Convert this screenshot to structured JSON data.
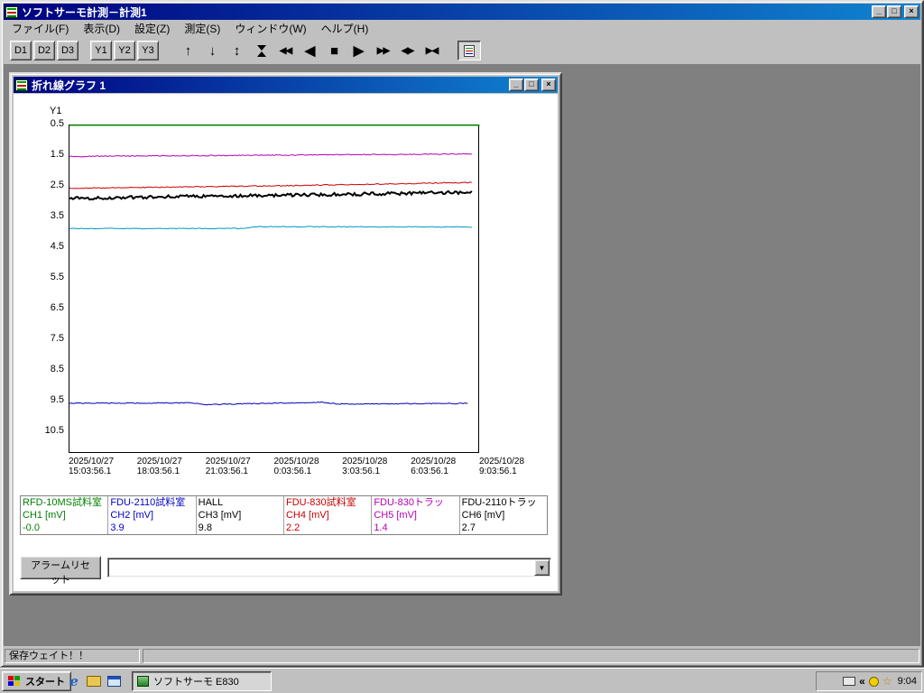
{
  "main_window": {
    "title": "ソフトサーモ計測－計測1",
    "menu_items": [
      "ファイル(F)",
      "表示(D)",
      "設定(Z)",
      "測定(S)",
      "ウィンドウ(W)",
      "ヘルプ(H)"
    ],
    "toolbar": {
      "display_buttons": [
        "D1",
        "D2",
        "D3"
      ],
      "axis_buttons": [
        "Y1",
        "Y2",
        "Y3"
      ],
      "nav_buttons": [
        {
          "name": "scroll-up",
          "glyph": "↑"
        },
        {
          "name": "scroll-down",
          "glyph": "↓"
        },
        {
          "name": "scroll-up-down",
          "glyph": "↕"
        },
        {
          "name": "hourglass",
          "glyph": ""
        },
        {
          "name": "rewind",
          "glyph": "◀◀"
        },
        {
          "name": "step-back",
          "glyph": "◀"
        },
        {
          "name": "stop",
          "glyph": "■"
        },
        {
          "name": "step-forward",
          "glyph": "▶"
        },
        {
          "name": "fast-forward",
          "glyph": "▶▶"
        },
        {
          "name": "expand-horizontal",
          "glyph": "◀▶"
        },
        {
          "name": "shrink-horizontal",
          "glyph": "▶◀"
        }
      ]
    },
    "status_text": "保存ウェイト！！"
  },
  "graph_window": {
    "title": "折れ線グラフ 1",
    "alarm_reset_label": "アラームリセット",
    "combo_value": ""
  },
  "window_controls": [
    {
      "name": "minimize",
      "glyph": "_"
    },
    {
      "name": "maximize",
      "glyph": "□"
    },
    {
      "name": "close",
      "glyph": "×"
    }
  ],
  "icons": {
    "dropdown": "▼",
    "tray_chevron": "«",
    "tray_star": "☆",
    "ie_glyph": "e"
  },
  "chart_data": {
    "type": "line",
    "y_axis_name": "Y1",
    "y_ticks": [
      0.5,
      1.5,
      2.5,
      3.5,
      4.5,
      5.5,
      6.5,
      7.5,
      8.5,
      9.5,
      10.5
    ],
    "y_axis_increases_downward": true,
    "x_ticks": [
      {
        "date": "2025/10/27",
        "time": "15:03:56.1"
      },
      {
        "date": "2025/10/27",
        "time": "18:03:56.1"
      },
      {
        "date": "2025/10/27",
        "time": "21:03:56.1"
      },
      {
        "date": "2025/10/28",
        "time": "0:03:56.1"
      },
      {
        "date": "2025/10/28",
        "time": "3:03:56.1"
      },
      {
        "date": "2025/10/28",
        "time": "6:03:56.1"
      },
      {
        "date": "2025/10/28",
        "time": "9:03:56.1"
      }
    ],
    "series": [
      {
        "name": "CH1",
        "color": "#00c800",
        "width": 1,
        "noise": 0,
        "points": [
          [
            0,
            0.5
          ],
          [
            1.0,
            0.5
          ]
        ]
      },
      {
        "name": "CH5",
        "color": "#b400b4",
        "width": 1,
        "noise": 0.015,
        "points": [
          [
            0,
            1.51
          ],
          [
            0.5,
            1.47
          ],
          [
            0.98,
            1.43
          ]
        ]
      },
      {
        "name": "CH4",
        "color": "#c80000",
        "width": 1,
        "noise": 0.015,
        "points": [
          [
            0,
            2.55
          ],
          [
            0.5,
            2.47
          ],
          [
            0.98,
            2.36
          ]
        ]
      },
      {
        "name": "CH6",
        "color": "#000000",
        "width": 2,
        "noise": 0.05,
        "points": [
          [
            0,
            2.88
          ],
          [
            0.25,
            2.82
          ],
          [
            0.6,
            2.76
          ],
          [
            0.98,
            2.68
          ]
        ]
      },
      {
        "name": "CH2",
        "color": "#0096c8",
        "width": 1,
        "noise": 0.012,
        "points": [
          [
            0,
            3.86
          ],
          [
            0.42,
            3.86
          ],
          [
            0.46,
            3.8
          ],
          [
            0.98,
            3.81
          ]
        ]
      },
      {
        "name": "CH3",
        "color": "#0000b4",
        "width": 1,
        "noise": 0.015,
        "points": [
          [
            0,
            9.56
          ],
          [
            0.3,
            9.54
          ],
          [
            0.33,
            9.6
          ],
          [
            0.62,
            9.52
          ],
          [
            0.65,
            9.58
          ],
          [
            0.97,
            9.56
          ]
        ]
      }
    ],
    "legend_channels": [
      {
        "device": "RFD-10MS試料室",
        "channel": "CH1 [mV]",
        "value": "-0.0",
        "color": "#008000"
      },
      {
        "device": "FDU-2110試料室",
        "channel": "CH2 [mV]",
        "value": "3.9",
        "color": "#0000c8"
      },
      {
        "device": "HALL",
        "channel": "CH3 [mV]",
        "value": "9.8",
        "color": "#000000"
      },
      {
        "device": "FDU-830試料室",
        "channel": "CH4 [mV]",
        "value": "2.2",
        "color": "#c80000"
      },
      {
        "device": "FDU-830トラッ",
        "channel": "CH5 [mV]",
        "value": "1.4",
        "color": "#b400b4"
      },
      {
        "device": "FDU-2110トラッ",
        "channel": "CH6 [mV]",
        "value": "2.7",
        "color": "#000000"
      }
    ]
  },
  "taskbar": {
    "start_label": "スタート",
    "task_button_label": "ソフトサーモ E830",
    "clock": "9:04"
  },
  "colors": {
    "titlebar_gradient_start": "#000080",
    "titlebar_gradient_end": "#1084d0",
    "chrome": "#c0c0c0",
    "mdi_background": "#808080"
  }
}
